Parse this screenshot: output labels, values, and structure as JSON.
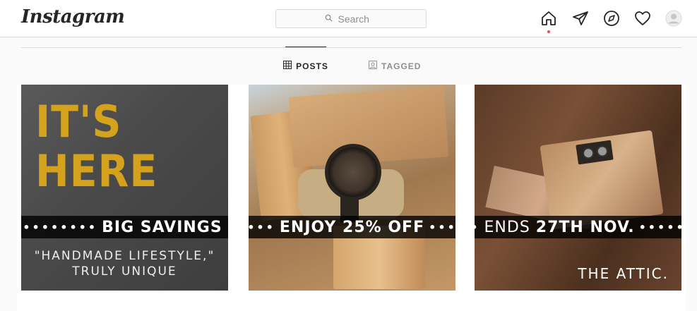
{
  "header": {
    "logo": "Instagram",
    "search_placeholder": "Search"
  },
  "nav_icons": [
    "home-icon",
    "direct-messages-icon",
    "explore-icon",
    "activity-heart-icon",
    "profile-avatar"
  ],
  "tabs": [
    {
      "label": "POSTS",
      "icon": "grid-icon",
      "active": true
    },
    {
      "label": "TAGGED",
      "icon": "tagged-icon",
      "active": false
    }
  ],
  "posts": [
    {
      "headline_line1": "IT'S",
      "headline_line2": "HERE",
      "banner": "BIG SAVINGS",
      "subtext_line1": "\"HANDMADE LIFESTYLE,\"",
      "subtext_line2": "TRULY UNIQUE"
    },
    {
      "banner": "ENJOY 25% OFF"
    },
    {
      "banner_prefix": "ENDS",
      "banner_emphasis": "27TH NOV.",
      "brand": "THE ATTIC."
    }
  ],
  "colors": {
    "accent_red": "#ed4956",
    "headline_gold": "#d4a21c",
    "border": "#dbdbdb"
  }
}
